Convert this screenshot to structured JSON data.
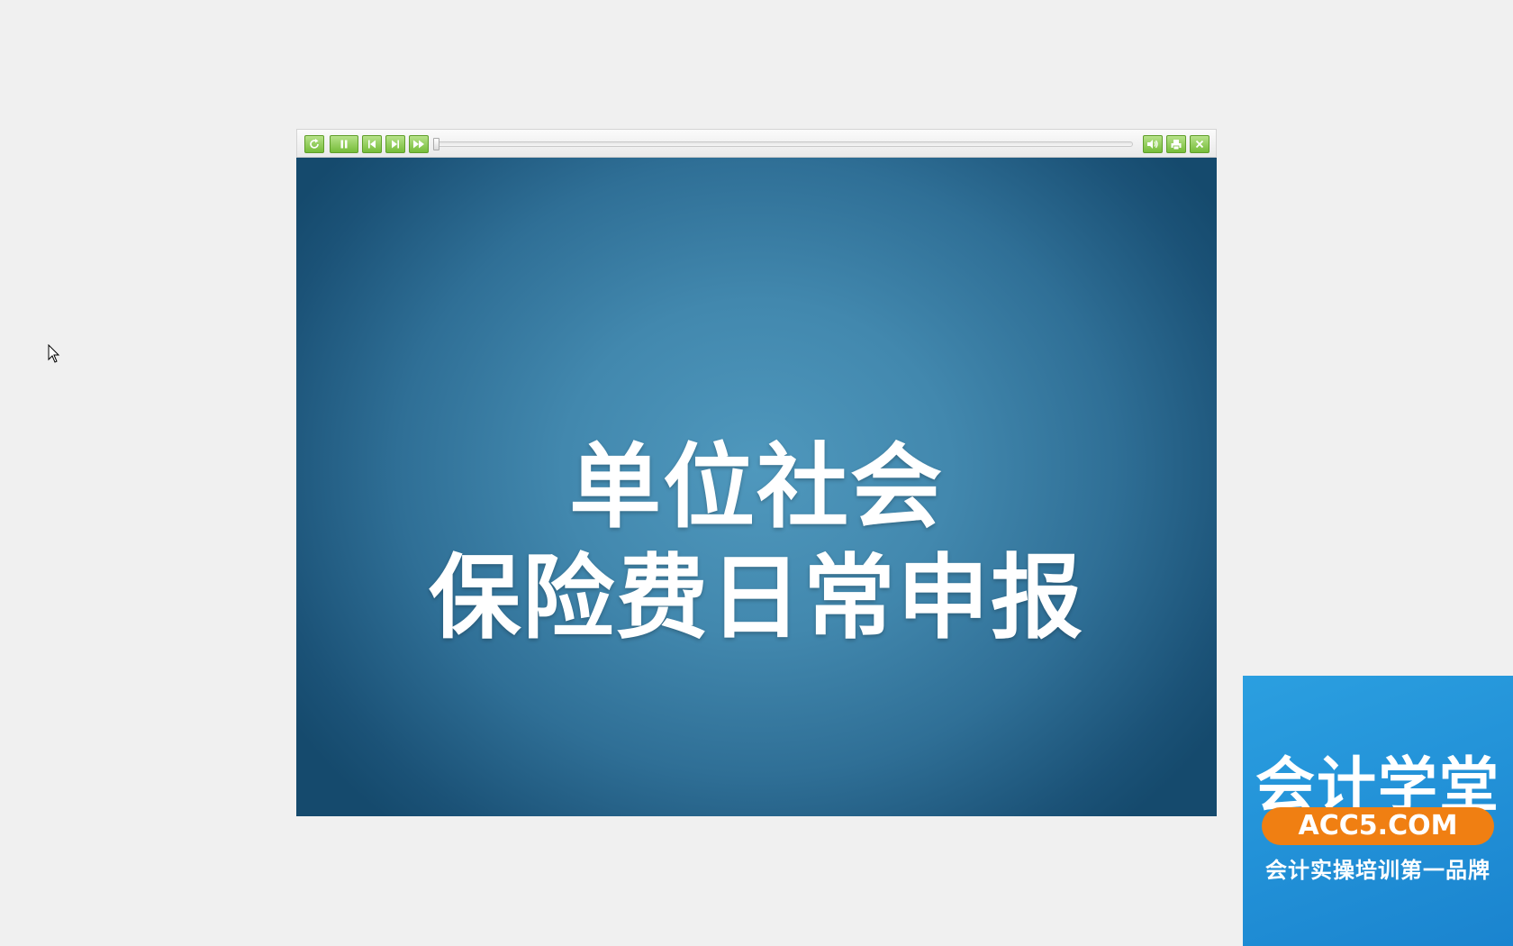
{
  "slide": {
    "title_line1": "单位社会",
    "title_line2": "保险费日常申报",
    "background_center": "#4f98bd",
    "background_edge": "#154a6d"
  },
  "toolbar": {
    "buttons": {
      "replay": "replay-icon",
      "pause": "pause-icon",
      "previous": "previous-icon",
      "next": "next-icon",
      "fast_forward": "fast-forward-icon",
      "volume": "volume-icon",
      "print": "print-icon",
      "close": "close-icon"
    },
    "accent": "#7cc142",
    "progress": 0
  },
  "watermark": {
    "title": "会计学堂",
    "site": "ACC5.COM",
    "slogan": "会计实操培训第一品牌",
    "background": "#1a8bd4",
    "pill_color": "#f07f12"
  }
}
